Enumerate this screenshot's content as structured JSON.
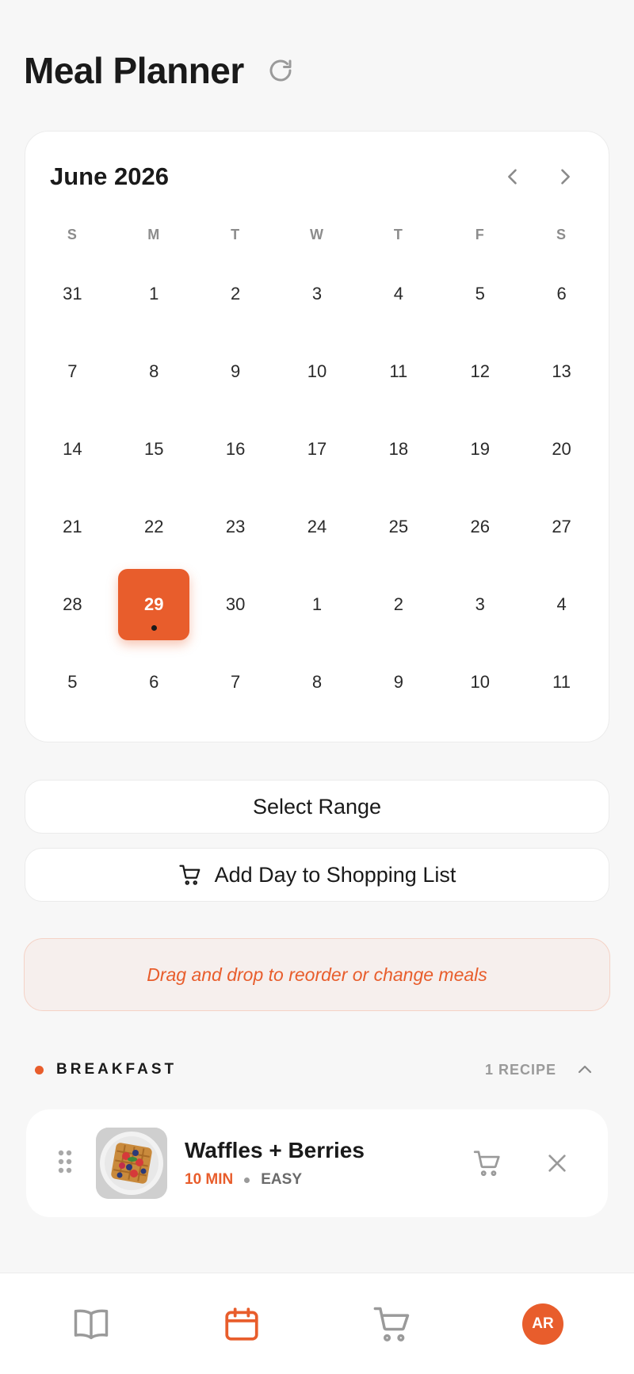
{
  "header": {
    "title": "Meal Planner"
  },
  "calendar": {
    "month_label": "June 2026",
    "weekdays": [
      "S",
      "M",
      "T",
      "W",
      "T",
      "F",
      "S"
    ],
    "days": [
      "31",
      "1",
      "2",
      "3",
      "4",
      "5",
      "6",
      "7",
      "8",
      "9",
      "10",
      "11",
      "12",
      "13",
      "14",
      "15",
      "16",
      "17",
      "18",
      "19",
      "20",
      "21",
      "22",
      "23",
      "24",
      "25",
      "26",
      "27",
      "28",
      "29",
      "30",
      "1",
      "2",
      "3",
      "4",
      "5",
      "6",
      "7",
      "8",
      "9",
      "10",
      "11"
    ],
    "selected_index": 29,
    "selected_has_meal": true
  },
  "actions": {
    "select_range": "Select Range",
    "add_day_to_shopping_list": "Add Day to Shopping List"
  },
  "hint": "Drag and drop to reorder or change meals",
  "section": {
    "title": "BREAKFAST",
    "count": "1 RECIPE"
  },
  "recipe": {
    "name": "Waffles + Berries",
    "time": "10 MIN",
    "difficulty": "EASY"
  },
  "tabbar": {
    "avatar_initials": "AR",
    "active_tab": "calendar"
  },
  "colors": {
    "accent": "#e85d2c",
    "background": "#f7f7f7",
    "card": "#ffffff",
    "muted": "#9a9a9a"
  },
  "icons": [
    "refresh-icon",
    "chevron-left-icon",
    "chevron-right-icon",
    "cart-icon",
    "drag-handle-icon",
    "close-icon",
    "chevron-up-icon",
    "book-icon",
    "calendar-icon"
  ]
}
